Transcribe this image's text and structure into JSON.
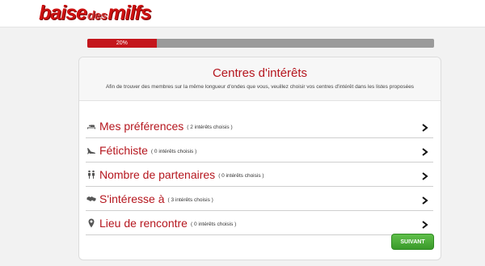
{
  "logo": {
    "part1": "baise",
    "part2": "des",
    "part3": "milfs"
  },
  "progress": {
    "label": "20%",
    "value": 0.2
  },
  "panel": {
    "title": "Centres d'intérêts",
    "subtitle": "Afin de trouver des membres sur la même longueur d'ondes que vous, veuillez choisir vos centres d'intérêt dans les listes proposées"
  },
  "rows": [
    {
      "label": "Mes préférences",
      "count": "( 2 intérêts choisis )",
      "icon": "bed-icon"
    },
    {
      "label": "Fétichiste",
      "count": "( 0 intérêts choisis )",
      "icon": "heel-icon"
    },
    {
      "label": "Nombre de partenaires",
      "count": "( 0 intérêts choisis )",
      "icon": "people-icon"
    },
    {
      "label": "S'intéresse à",
      "count": "( 3 intérêts choisis )",
      "icon": "handshake-icon"
    },
    {
      "label": "Lieu de rencontre",
      "count": "( 0 intérêts choisis )",
      "icon": "map-marker-icon"
    }
  ],
  "next_button": {
    "label": "SUIVANT"
  },
  "colors": {
    "accent": "#b5161e",
    "progress_fill": "#c4161c",
    "button": "#4aa836"
  }
}
